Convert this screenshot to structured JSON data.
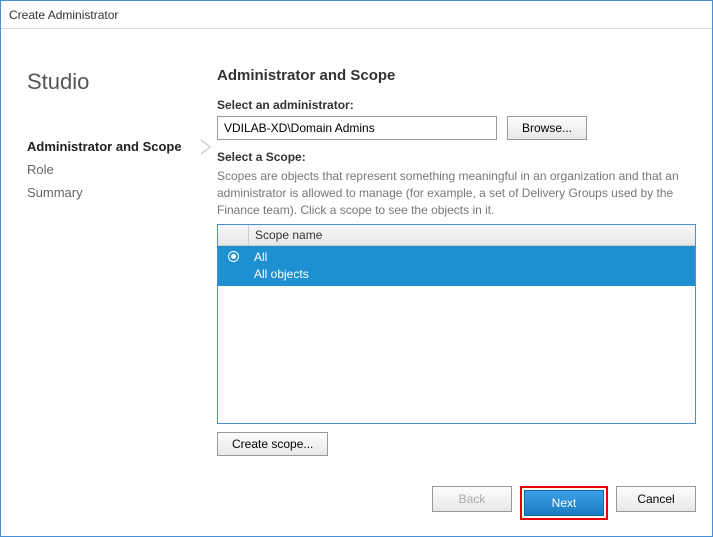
{
  "window": {
    "title": "Create Administrator"
  },
  "sidebar": {
    "app_name": "Studio",
    "items": [
      {
        "label": "Administrator and Scope",
        "active": true
      },
      {
        "label": "Role",
        "active": false
      },
      {
        "label": "Summary",
        "active": false
      }
    ]
  },
  "main": {
    "heading": "Administrator and Scope",
    "admin_label": "Select an administrator:",
    "admin_value": "VDILAB-XD\\Domain Admins",
    "browse_label": "Browse...",
    "scope_label": "Select a Scope:",
    "scope_desc": "Scopes are objects that represent something meaningful in an organization and that an administrator is allowed to manage (for example, a set of Delivery Groups used by the Finance team). Click a scope to see the objects in it.",
    "scope_header": "Scope name",
    "scopes": [
      {
        "name": "All",
        "desc": "All objects",
        "selected": true
      }
    ],
    "create_scope_label": "Create scope..."
  },
  "footer": {
    "back": "Back",
    "next": "Next",
    "cancel": "Cancel"
  }
}
